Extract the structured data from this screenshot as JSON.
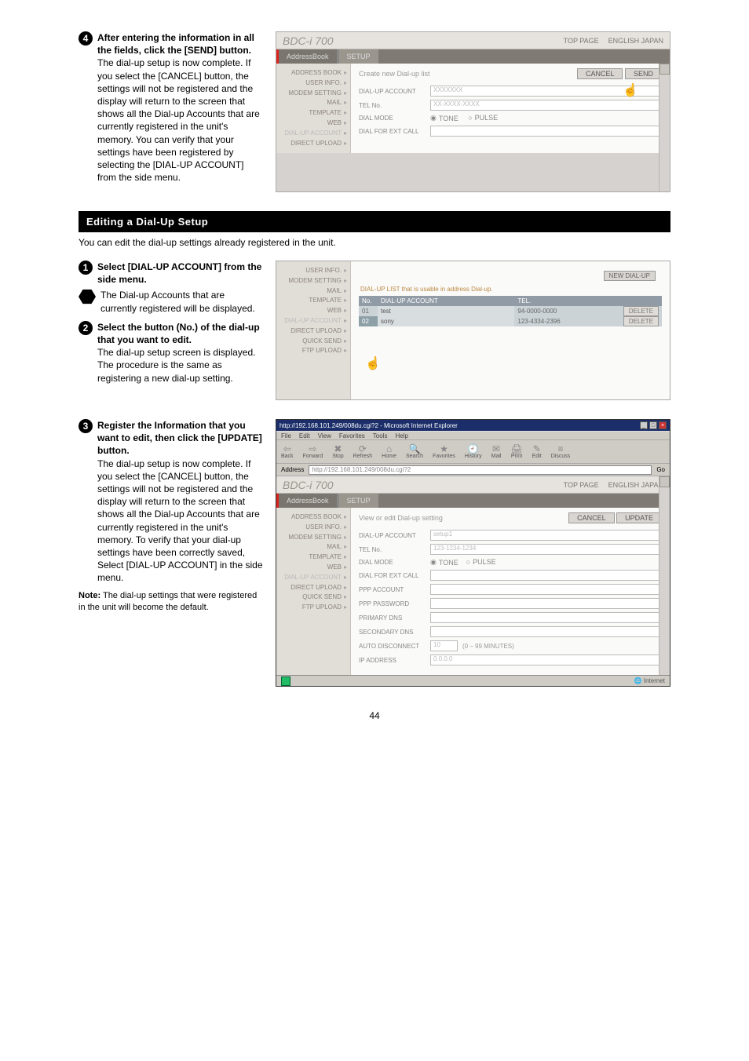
{
  "page_number": "44",
  "steps": {
    "s4": {
      "lead": "After entering the information in all the fields, click the [SEND] button.",
      "body": "The dial-up setup is now complete. If you select the [CANCEL] button, the settings will not be registered and the display will return to the screen that shows all the Dial-up Accounts that are currently registered in the unit's memory. You can verify that your settings have been registered by selecting the [DIAL-UP ACCOUNT] from the side menu."
    },
    "s1": {
      "lead": "Select [DIAL-UP ACCOUNT] from the side menu.",
      "sub": "The Dial-up Accounts that are currently registered will be displayed."
    },
    "s2": {
      "lead": "Select the button (No.) of the dial-up that you want to edit.",
      "body": "The dial-up setup screen is displayed. The procedure is the same as registering a new dial-up setting."
    },
    "s3": {
      "lead": "Register the Information that you want to edit, then click the [UPDATE] button.",
      "body": "The dial-up setup is now complete. If you select the [CANCEL] button, the settings will not be registered and the display will return to the screen that shows all the Dial-up Accounts that are currently registered in the unit's memory. To verify that your dial-up settings have been correctly saved, Select [DIAL-UP ACCOUNT] in the side menu.",
      "note_label": "Note:",
      "note_body": "The dial-up settings that were registered in the unit will become the default."
    }
  },
  "section": {
    "title": "Editing a Dial-Up Setup",
    "subtitle": "You can edit the dial-up settings already registered in the unit."
  },
  "shot1": {
    "brand": "BDC-i 700",
    "topnav": [
      "TOP PAGE",
      "ENGLISH JAPAN"
    ],
    "tabs": [
      "AddressBook",
      "SETUP"
    ],
    "sidebar": [
      "ADDRESS BOOK",
      "USER INFO.",
      "MODEM SETTING",
      "MAIL",
      "TEMPLATE",
      "WEB",
      "DIAL-UP ACCOUNT",
      "DIRECT UPLOAD"
    ],
    "heading": "Create new Dial-up list",
    "btn_send": "SEND",
    "btn_cancel": "CANCEL",
    "rows": {
      "acct": {
        "label": "DIAL-UP ACCOUNT",
        "value": "XXXXXXX"
      },
      "tel": {
        "label": "TEL No.",
        "value": "XX-XXXX-XXXX"
      },
      "mode": {
        "label": "DIAL MODE",
        "tone": "TONE",
        "pulse": "PULSE"
      },
      "ext": {
        "label": "DIAL FOR EXT CALL",
        "value": ""
      }
    }
  },
  "shot2": {
    "newbtn": "NEW DIAL-UP",
    "caption": "DIAL-UP LIST that is usable in address Dial-up.",
    "sidebar": [
      "USER INFO.",
      "MODEM SETTING",
      "MAIL",
      "TEMPLATE",
      "WEB",
      "DIAL-UP ACCOUNT",
      "DIRECT UPLOAD",
      "QUICK SEND",
      "FTP UPLOAD"
    ],
    "cols": {
      "no": "No.",
      "acct": "DIAL-UP ACCOUNT",
      "tel": "TEL."
    },
    "rows": [
      {
        "no": "01",
        "name": "test",
        "tel": "94-0000-0000"
      },
      {
        "no": "02",
        "name": "sony",
        "tel": "123-4334-2396"
      }
    ],
    "delete": "DELETE"
  },
  "shot3": {
    "title": "http://192.168.101.249/008du.cgi?2 - Microsoft Internet Explorer",
    "menus": [
      "File",
      "Edit",
      "View",
      "Favorites",
      "Tools",
      "Help"
    ],
    "tools": [
      "Back",
      "Forward",
      "Stop",
      "Refresh",
      "Home",
      "Search",
      "Favorites",
      "History",
      "Mail",
      "Print",
      "Edit",
      "Discuss"
    ],
    "addr_label": "Address",
    "addr": "http://192.168.101.249/008du.cgi?2",
    "go": "Go",
    "brand": "BDC-i 700",
    "topnav": [
      "TOP PAGE",
      "ENGLISH JAPAN"
    ],
    "tabs": [
      "AddressBook",
      "SETUP"
    ],
    "sidebar": [
      "ADDRESS BOOK",
      "USER INFO.",
      "MODEM SETTING",
      "MAIL",
      "TEMPLATE",
      "WEB",
      "DIAL-UP ACCOUNT",
      "DIRECT UPLOAD",
      "QUICK SEND",
      "FTP UPLOAD"
    ],
    "heading": "View or edit Dial-up setting",
    "btn_cancel": "CANCEL",
    "btn_update": "UPDATE",
    "rows": {
      "acct": {
        "label": "DIAL-UP ACCOUNT",
        "value": "setup1"
      },
      "tel": {
        "label": "TEL No.",
        "value": "123-1234-1234"
      },
      "mode": {
        "label": "DIAL MODE",
        "tone": "TONE",
        "pulse": "PULSE"
      },
      "ext": {
        "label": "DIAL FOR EXT CALL",
        "value": ""
      },
      "ppp": {
        "label": "PPP ACCOUNT",
        "value": ""
      },
      "pwd": {
        "label": "PPP PASSWORD",
        "value": ""
      },
      "dns1": {
        "label": "PRIMARY DNS",
        "value": ""
      },
      "dns2": {
        "label": "SECONDARY DNS",
        "value": ""
      },
      "auto": {
        "label": "AUTO DISCONNECT",
        "value": "10",
        "unit": "(0 – 99 MINUTES)"
      },
      "ip": {
        "label": "IP ADDRESS",
        "value": "0.0.0.0"
      }
    },
    "status": "Internet",
    "win": {
      "min": "_",
      "max": "□",
      "close": "×"
    }
  }
}
